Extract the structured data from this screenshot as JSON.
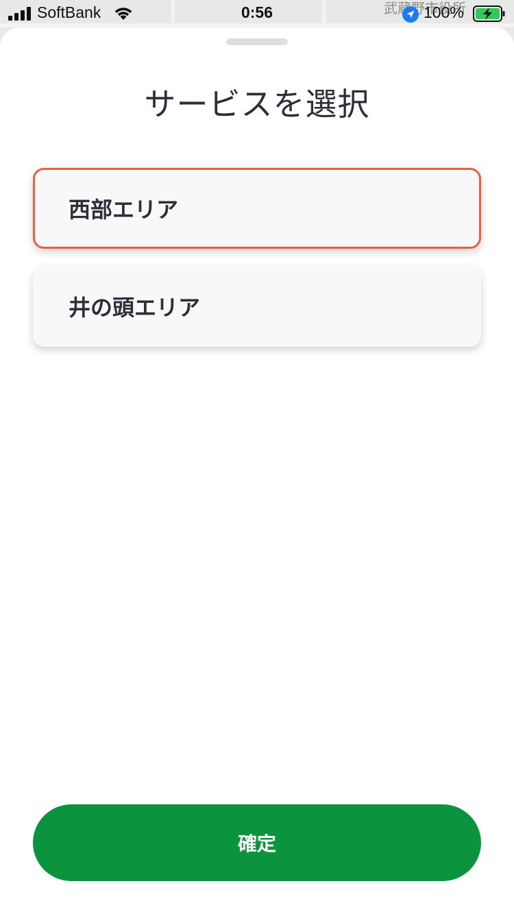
{
  "status_bar": {
    "carrier": "SoftBank",
    "time": "0:56",
    "battery_percent": "100%",
    "icons": [
      "signal-icon",
      "wifi-icon",
      "location-arrow-icon",
      "battery-charging-icon"
    ]
  },
  "map": {
    "label": "武蔵野市役所"
  },
  "sheet": {
    "title": "サービスを選択",
    "options": [
      {
        "label": "西部エリア",
        "selected": true
      },
      {
        "label": "井の頭エリア",
        "selected": false
      }
    ],
    "confirm_label": "確定"
  },
  "colors": {
    "accent_selected_border": "#ea6042",
    "confirm_button": "#0b943d",
    "location_icon": "#1a7cf5",
    "battery_fill": "#34c759",
    "title_text": "#2b2f3a"
  }
}
